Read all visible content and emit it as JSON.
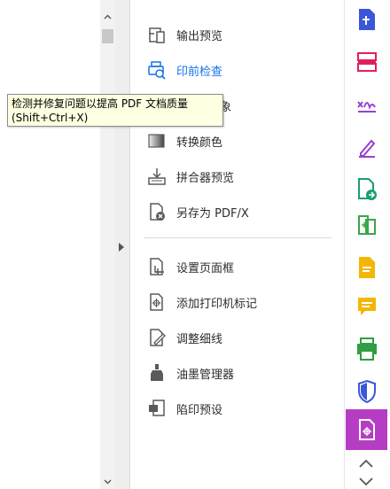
{
  "tooltip": {
    "text": "检测并修复问题以提高 PDF 文档质量",
    "shortcut": "(Shift+Ctrl+X)"
  },
  "tools": {
    "output_preview": "输出预览",
    "preflight": "印前检查",
    "fix_hairlines_hidden": "象",
    "convert_colors": "转换颜色",
    "flattener_preview": "拼合器预览",
    "save_as_pdfx": "另存为 PDF/X",
    "set_page_boxes": "设置页面框",
    "add_printer_marks": "添加打印机标记",
    "fix_hairlines": "调整细线",
    "ink_manager": "油墨管理器",
    "trap_presets": "陷印预设"
  },
  "colors": {
    "accent": "#1473e6",
    "rail_active": "#b53dc4"
  },
  "rail_icons": [
    "export-pdf-icon",
    "organize-pages-icon",
    "fill-sign-icon",
    "sign-icon",
    "send-for-review-icon",
    "compress-icon",
    "comment-icon",
    "sticky-note-icon",
    "scan-ocr-icon",
    "protect-icon",
    "print-production-icon"
  ]
}
